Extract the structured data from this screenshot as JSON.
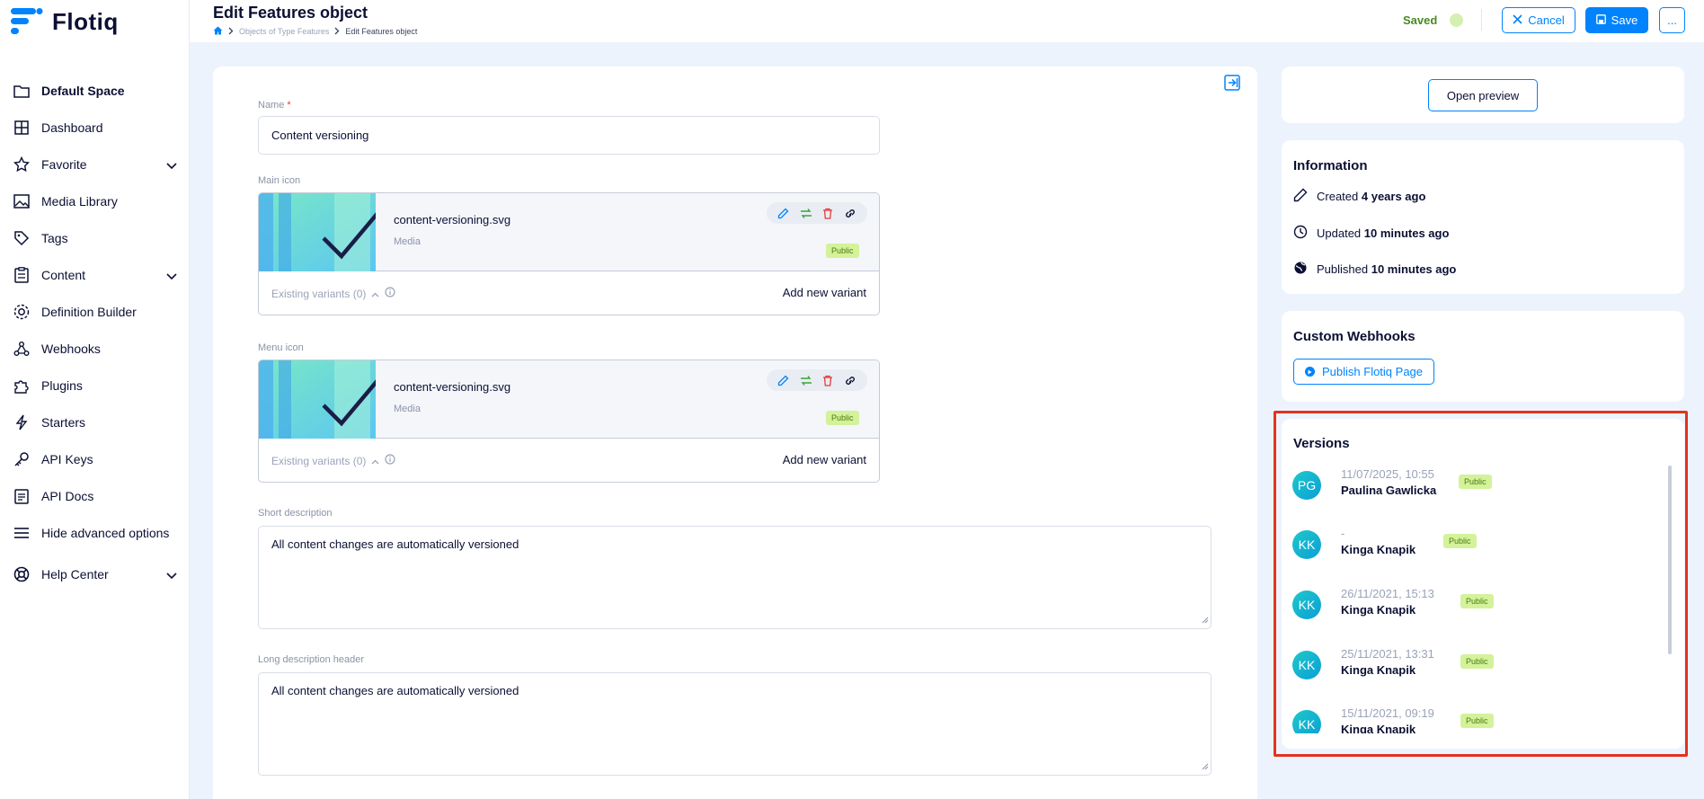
{
  "app": {
    "logo_text": "Flotiq"
  },
  "sidebar": {
    "items": [
      {
        "label": "Default Space",
        "icon": "folder-icon"
      },
      {
        "label": "Dashboard",
        "icon": "grid-icon"
      },
      {
        "label": "Favorite",
        "icon": "star-icon"
      },
      {
        "label": "Media Library",
        "icon": "image-icon"
      },
      {
        "label": "Tags",
        "icon": "tag-icon"
      },
      {
        "label": "Content",
        "icon": "clipboard-icon"
      },
      {
        "label": "Definition Builder",
        "icon": "gear-icon"
      },
      {
        "label": "Webhooks",
        "icon": "webhook-icon"
      },
      {
        "label": "Plugins",
        "icon": "puzzle-icon"
      },
      {
        "label": "Starters",
        "icon": "bolt-icon"
      },
      {
        "label": "API Keys",
        "icon": "key-icon"
      },
      {
        "label": "API Docs",
        "icon": "docs-icon"
      },
      {
        "label": "Hide advanced options",
        "icon": "menu-icon"
      },
      {
        "label": "Help Center",
        "icon": "lifebuoy-icon"
      }
    ]
  },
  "header": {
    "title": "Edit Features object",
    "breadcrumb": [
      "Objects of Type Features",
      "Edit Features object"
    ],
    "status": "Saved",
    "cancel_label": "Cancel",
    "save_label": "Save",
    "more_label": "..."
  },
  "form": {
    "name": {
      "label": "Name",
      "required_mark": "*",
      "value": "Content versioning"
    },
    "main_icon": {
      "label": "Main icon",
      "file_name": "content-versioning.svg",
      "file_type": "Media",
      "badge": "Public",
      "variants_label": "Existing variants (0)",
      "add_variant_label": "Add new variant"
    },
    "menu_icon": {
      "label": "Menu icon",
      "file_name": "content-versioning.svg",
      "file_type": "Media",
      "badge": "Public",
      "variants_label": "Existing variants (0)",
      "add_variant_label": "Add new variant"
    },
    "short_description": {
      "label": "Short description",
      "value": "All content changes are automatically versioned"
    },
    "long_description_header": {
      "label": "Long description header",
      "value": "All content changes are automatically versioned"
    }
  },
  "right": {
    "preview_label": "Open preview",
    "information": {
      "title": "Information",
      "created_label": "Created",
      "created_value": "4 years ago",
      "updated_label": "Updated",
      "updated_value": "10 minutes ago",
      "published_label": "Published",
      "published_value": "10 minutes ago"
    },
    "webhooks": {
      "title": "Custom Webhooks",
      "button_label": "Publish Flotiq Page"
    },
    "versions": {
      "title": "Versions",
      "items": [
        {
          "initials": "PG",
          "date": "11/07/2025, 10:55",
          "author": "Paulina Gawlicka",
          "status": "Public"
        },
        {
          "initials": "KK",
          "date": "-",
          "author": "Kinga Knapik",
          "status": "Public"
        },
        {
          "initials": "KK",
          "date": "26/11/2021, 15:13",
          "author": "Kinga Knapik",
          "status": "Public"
        },
        {
          "initials": "KK",
          "date": "25/11/2021, 13:31",
          "author": "Kinga Knapik",
          "status": "Public"
        },
        {
          "initials": "KK",
          "date": "15/11/2021, 09:19",
          "author": "Kinga Knapik",
          "status": "Public"
        }
      ]
    }
  },
  "colors": {
    "accent": "#0083fc",
    "highlight": "#e3321f",
    "public_badge_bg": "#d3f29a",
    "saved_text": "#4a8a22"
  }
}
